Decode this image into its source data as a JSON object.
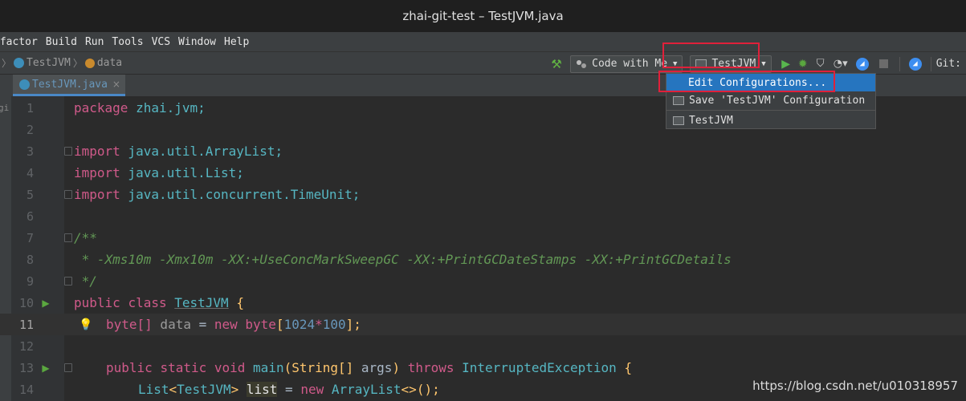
{
  "window": {
    "title": "zhai-git-test – TestJVM.java"
  },
  "menu": [
    "efactor",
    "Build",
    "Run",
    "Tools",
    "VCS",
    "Window",
    "Help"
  ],
  "breadcrumbs": [
    {
      "icon": "class-icon",
      "label": "TestJVM"
    },
    {
      "icon": "field-icon",
      "label": "data"
    }
  ],
  "toolbar": {
    "code_with_me": "Code with Me",
    "run_config": "TestJVM",
    "git_label": "Git:"
  },
  "tab": {
    "label": "TestJVM.java",
    "close": "×"
  },
  "gutter_edge": "gi",
  "dropdown": {
    "items": [
      {
        "label": "Edit Configurations..."
      },
      {
        "label": "Save 'TestJVM' Configuration"
      },
      {
        "label": "TestJVM"
      }
    ]
  },
  "lines": [
    {
      "n": "1"
    },
    {
      "n": "2"
    },
    {
      "n": "3"
    },
    {
      "n": "4"
    },
    {
      "n": "5"
    },
    {
      "n": "6"
    },
    {
      "n": "7"
    },
    {
      "n": "8"
    },
    {
      "n": "9"
    },
    {
      "n": "10"
    },
    {
      "n": "11"
    },
    {
      "n": "12"
    },
    {
      "n": "13"
    },
    {
      "n": "14"
    }
  ],
  "code": {
    "l1": {
      "kw": "package",
      "rest": " zhai.jvm;"
    },
    "l3": {
      "kw": "import",
      "rest": " java.util.ArrayList;"
    },
    "l4": {
      "kw": "import",
      "rest": " java.util.List;"
    },
    "l5": {
      "kw": "import",
      "rest": " java.util.concurrent.TimeUnit;"
    },
    "l7": "/**",
    "l8": " * -Xms10m -Xmx10m -XX:+UseConcMarkSweepGC -XX:+PrintGCDateStamps -XX:+PrintGCDetails",
    "l9": " */",
    "l10": {
      "kw1": "public",
      "kw2": "class",
      "name": "TestJVM",
      "brace": " {"
    },
    "l11": {
      "type": "byte",
      "br": "[]",
      "var": " data ",
      "eq": "= ",
      "kw": "new",
      "type2": " byte",
      "open": "[",
      "n1": "1024",
      "op": "*",
      "n2": "100",
      "close": "];"
    },
    "l13": {
      "kw1": "public",
      "kw2": "static",
      "kw3": "void",
      "fn": "main",
      "p1": "(String[] ",
      "arg": "args",
      "p2": ") ",
      "kw4": "throws",
      "ex": " InterruptedException",
      "brace": " {"
    },
    "l14": {
      "t1": "List",
      "lt": "<",
      "t2": "TestJVM",
      "gt": "> ",
      "var": "list",
      "eq": " = ",
      "kw": "new",
      "t3": " ArrayList",
      "rest": "<>();"
    }
  },
  "watermark": "https://blog.csdn.net/u010318957"
}
